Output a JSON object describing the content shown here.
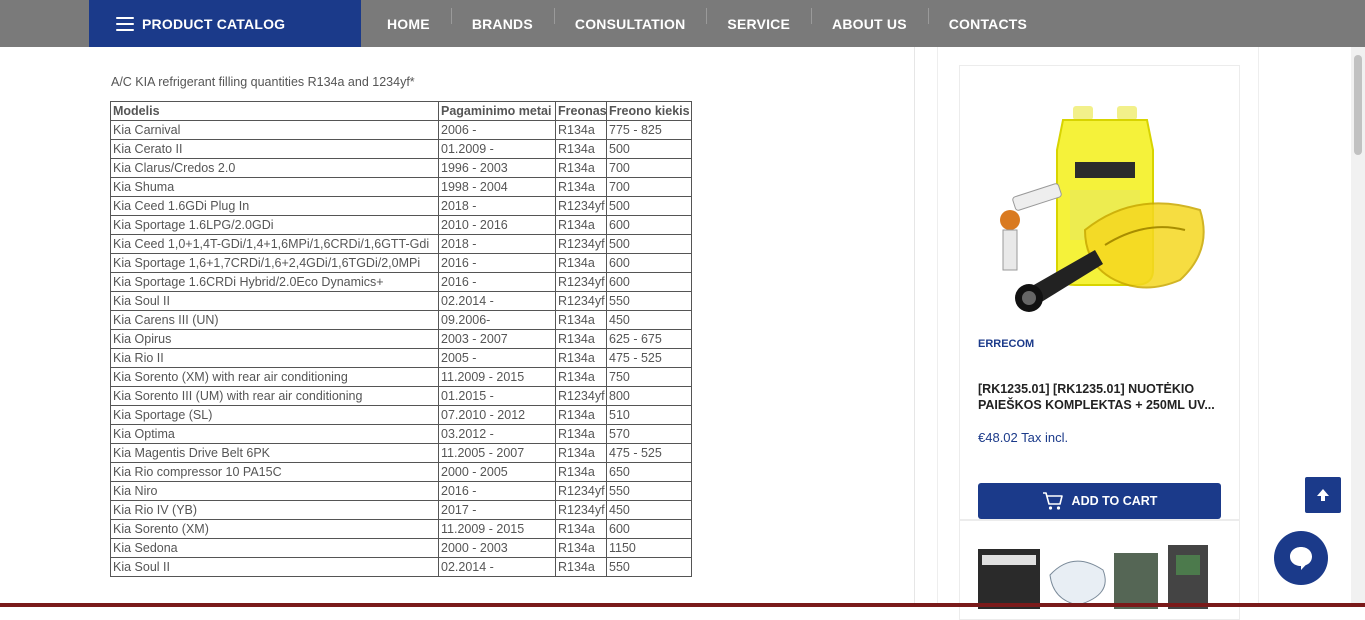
{
  "header": {
    "catalog_label": "PRODUCT CATALOG",
    "nav": [
      "HOME",
      "BRANDS",
      "CONSULTATION",
      "SERVICE",
      "ABOUT US",
      "CONTACTS"
    ]
  },
  "main": {
    "intro": "A/C KIA refrigerant filling quantities R134a and 1234yf*",
    "table": {
      "headers": [
        "Modelis",
        "Pagaminimo metai",
        "Freonas",
        "Freono kiekis"
      ],
      "rows": [
        [
          "Kia Carnival",
          "2006 -",
          "R134a",
          "775 - 825"
        ],
        [
          "Kia Cerato II",
          "01.2009 -",
          "R134a",
          "500"
        ],
        [
          "Kia Clarus/Credos 2.0",
          "1996 - 2003",
          "R134a",
          "700"
        ],
        [
          "Kia Shuma",
          "1998 - 2004",
          "R134a",
          "700"
        ],
        [
          "Kia Ceed 1.6GDi Plug In",
          "2018 -",
          "R1234yf",
          "500"
        ],
        [
          "Kia Sportage 1.6LPG/2.0GDi",
          "2010 - 2016",
          "R134a",
          "600"
        ],
        [
          "Kia Ceed 1,0+1,4T-GDi/1,4+1,6MPi/1,6CRDi/1,6GTT-Gdi",
          "2018 -",
          "R1234yf",
          "500"
        ],
        [
          "Kia Sportage 1,6+1,7CRDi/1,6+2,4GDi/1,6TGDi/2,0MPi",
          "2016 -",
          "R134a",
          "600"
        ],
        [
          "Kia Sportage 1.6CRDi Hybrid/2.0Eco Dynamics+",
          "2016 -",
          "R1234yf",
          "600"
        ],
        [
          "Kia Soul II",
          "02.2014 -",
          "R1234yf",
          "550"
        ],
        [
          "Kia Carens III (UN)",
          "09.2006-",
          "R134a",
          "450"
        ],
        [
          "Kia Opirus",
          "2003 - 2007",
          "R134a",
          "625 - 675"
        ],
        [
          "Kia Rio II",
          "2005 -",
          "R134a",
          "475 - 525"
        ],
        [
          "Kia Sorento (XM) with rear air conditioning",
          "11.2009 - 2015",
          "R134a",
          "750"
        ],
        [
          "Kia Sorento III (UM) with rear air conditioning",
          "01.2015 -",
          "R1234yf",
          "800"
        ],
        [
          "Kia Sportage (SL)",
          "07.2010 - 2012",
          "R134a",
          "510"
        ],
        [
          "Kia Optima",
          "03.2012 -",
          "R134a",
          "570"
        ],
        [
          "Kia Magentis Drive Belt 6PK",
          "11.2005 - 2007",
          "R134a",
          "475 - 525"
        ],
        [
          "Kia Rio compressor 10 PA15C",
          "2000 - 2005",
          "R134a",
          "650"
        ],
        [
          "Kia Niro",
          "2016 -",
          "R1234yf",
          "550"
        ],
        [
          "Kia Rio IV (YB)",
          "2017 -",
          "R1234yf",
          "450"
        ],
        [
          "Kia Sorento (XM)",
          "11.2009 - 2015",
          "R134a",
          "600"
        ],
        [
          "Kia Sedona",
          "2000 - 2003",
          "R134a",
          "1150"
        ],
        [
          "Kia Soul II",
          "02.2014 -",
          "R134a",
          "550"
        ]
      ]
    }
  },
  "sidebar": {
    "product": {
      "brand": "ERRECOM",
      "name": "[RK1235.01] [RK1235.01] NUOTĖKIO PAIEŠKOS KOMPLEKTAS + 250ML UV...",
      "price": "€48.02 Tax incl.",
      "add_to_cart": "ADD TO CART"
    }
  },
  "colors": {
    "brand_blue": "#1b3a8a",
    "header_gray": "#7a7a7a"
  }
}
